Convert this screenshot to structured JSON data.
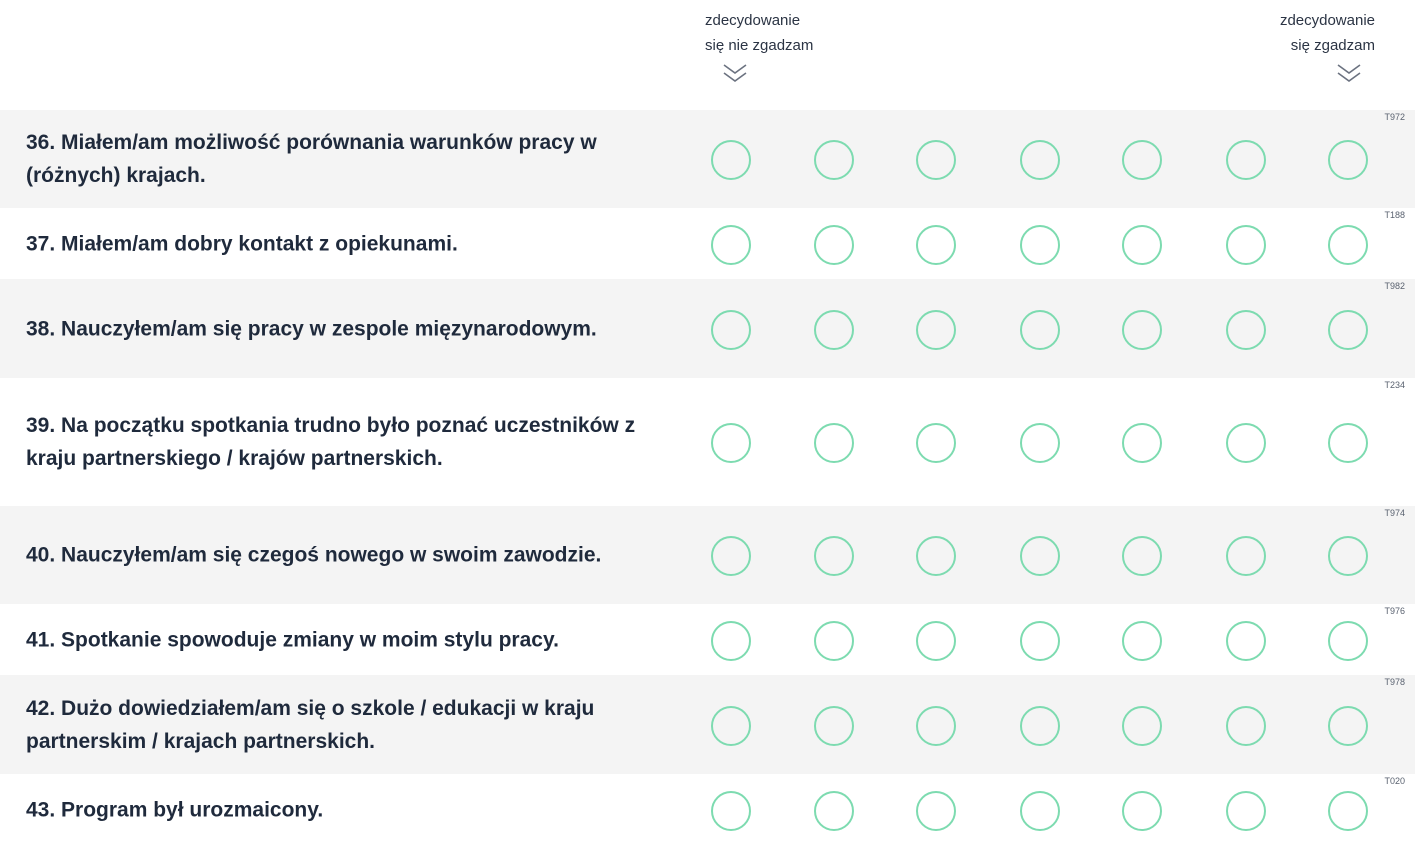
{
  "scale": {
    "left_label_line1": "zdecydowanie",
    "left_label_line2": "się nie zgadzam",
    "right_label_line1": "zdecydowanie",
    "right_label_line2": "się zgadzam",
    "chevron_icon": "double-chevron-down-icon",
    "options_per_row": 7,
    "option_color": "#7ddbb0"
  },
  "questions": [
    {
      "code": "T972",
      "text": "36. Miałem/am możliwość porównania warunków pracy w (różnych) krajach."
    },
    {
      "code": "T188",
      "text": "37. Miałem/am dobry kontakt z opiekunami."
    },
    {
      "code": "T982",
      "text": "38. Nauczyłem/am się pracy w zespole mięzynarodowym."
    },
    {
      "code": "T234",
      "text": "39. Na początku spotkania trudno było poznać uczestników z kraju partnerskiego / krajów partnerskich."
    },
    {
      "code": "T974",
      "text": "40. Nauczyłem/am się czegoś nowego w swoim zawodzie."
    },
    {
      "code": "T976",
      "text": "41. Spotkanie spowoduje zmiany w moim stylu pracy."
    },
    {
      "code": "T978",
      "text": "42. Dużo dowiedziałem/am się o szkole / edukacji w kraju partnerskim / krajach partnerskich."
    },
    {
      "code": "T020",
      "text": "43. Program był urozmaicony."
    }
  ]
}
